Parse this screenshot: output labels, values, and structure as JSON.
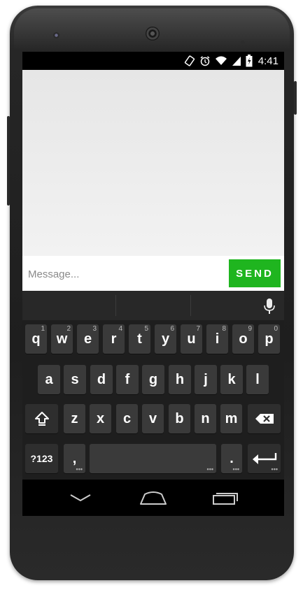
{
  "status_bar": {
    "time": "4:41",
    "icons": [
      "rotate-icon",
      "alarm-icon",
      "wifi-icon",
      "signal-icon",
      "battery-icon"
    ]
  },
  "compose": {
    "placeholder": "Message...",
    "send_label": "SEND",
    "send_color": "#1fb51f"
  },
  "keyboard": {
    "row1": [
      {
        "label": "q",
        "hint": "1"
      },
      {
        "label": "w",
        "hint": "2"
      },
      {
        "label": "e",
        "hint": "3"
      },
      {
        "label": "r",
        "hint": "4"
      },
      {
        "label": "t",
        "hint": "5"
      },
      {
        "label": "y",
        "hint": "6"
      },
      {
        "label": "u",
        "hint": "7"
      },
      {
        "label": "i",
        "hint": "8"
      },
      {
        "label": "o",
        "hint": "9"
      },
      {
        "label": "p",
        "hint": "0"
      }
    ],
    "row2": [
      "a",
      "s",
      "d",
      "f",
      "g",
      "h",
      "j",
      "k",
      "l"
    ],
    "row3": [
      "z",
      "x",
      "c",
      "v",
      "b",
      "n",
      "m"
    ],
    "symbols_label": "?123",
    "comma_label": ",",
    "period_label": "."
  },
  "nav_icons": [
    "back-icon",
    "home-icon",
    "recents-icon"
  ]
}
